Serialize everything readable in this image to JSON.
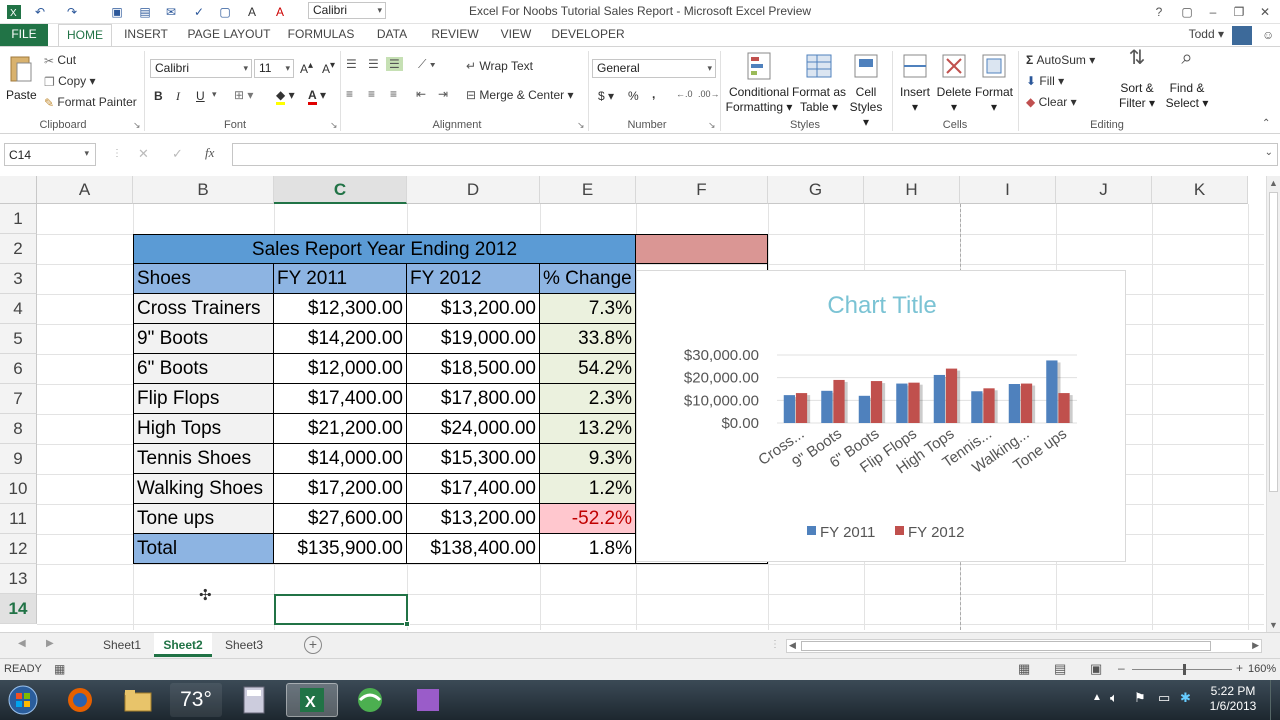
{
  "window": {
    "title": "Excel For Noobs Tutorial Sales Report - Microsoft Excel Preview",
    "user": "Todd",
    "qat_font": "Calibri"
  },
  "menu": {
    "tabs": [
      "FILE",
      "HOME",
      "INSERT",
      "PAGE LAYOUT",
      "FORMULAS",
      "DATA",
      "REVIEW",
      "VIEW",
      "DEVELOPER"
    ]
  },
  "ribbon": {
    "clipboard": {
      "paste": "Paste",
      "cut": "Cut",
      "copy": "Copy",
      "format_painter": "Format Painter",
      "label": "Clipboard"
    },
    "font": {
      "name": "Calibri",
      "size": "11",
      "bold": "B",
      "italic": "I",
      "underline": "U",
      "label": "Font"
    },
    "alignment": {
      "wrap": "Wrap Text",
      "merge": "Merge & Center",
      "label": "Alignment"
    },
    "number": {
      "format": "General",
      "currency": "$",
      "percent": "%",
      "comma": ",",
      "label": "Number"
    },
    "styles": {
      "conditional": "Conditional",
      "conditional2": "Formatting",
      "format_as": "Format as",
      "format_as2": "Table",
      "cell": "Cell",
      "cell2": "Styles",
      "label": "Styles"
    },
    "cells": {
      "insert": "Insert",
      "delete": "Delete",
      "format": "Format",
      "label": "Cells"
    },
    "editing": {
      "autosum": "AutoSum",
      "fill": "Fill",
      "clear": "Clear",
      "sort": "Sort &",
      "sort2": "Filter",
      "find": "Find &",
      "find2": "Select",
      "label": "Editing"
    }
  },
  "formula_bar": {
    "name_box": "C14",
    "fx": "fx",
    "cancel": "✕",
    "enter": "✓",
    "content": ""
  },
  "columns": [
    "A",
    "B",
    "C",
    "D",
    "E",
    "F",
    "G",
    "H",
    "I",
    "J",
    "K"
  ],
  "rows": [
    "1",
    "2",
    "3",
    "4",
    "5",
    "6",
    "7",
    "8",
    "9",
    "10",
    "11",
    "12",
    "13",
    "14"
  ],
  "table": {
    "title": "Sales Report Year Ending 2012",
    "headers": [
      "Shoes",
      "FY 2011",
      "FY 2012",
      "% Change"
    ],
    "rows": [
      [
        "Cross Trainers",
        "$12,300.00",
        "$13,200.00",
        "7.3%"
      ],
      [
        "9\" Boots",
        "$14,200.00",
        "$19,000.00",
        "33.8%"
      ],
      [
        "6\" Boots",
        "$12,000.00",
        "$18,500.00",
        "54.2%"
      ],
      [
        "Flip Flops",
        "$17,400.00",
        "$17,800.00",
        "2.3%"
      ],
      [
        "High Tops",
        "$21,200.00",
        "$24,000.00",
        "13.2%"
      ],
      [
        "Tennis Shoes",
        "$14,000.00",
        "$15,300.00",
        "9.3%"
      ],
      [
        "Walking Shoes",
        "$17,200.00",
        "$17,400.00",
        "1.2%"
      ],
      [
        "Tone ups",
        "$27,600.00",
        "$13,200.00",
        "-52.2%"
      ]
    ],
    "total": [
      "Total",
      "$135,900.00",
      "$138,400.00",
      "1.8%"
    ]
  },
  "chart_data": {
    "type": "bar",
    "title": "Chart Title",
    "categories": [
      "Cross...",
      "9\" Boots",
      "6\" Boots",
      "Flip Flops",
      "High Tops",
      "Tennis...",
      "Walking...",
      "Tone ups"
    ],
    "series": [
      {
        "name": "FY 2011",
        "values": [
          12300,
          14200,
          12000,
          17400,
          21200,
          14000,
          17200,
          27600
        ],
        "color": "#4f81bd"
      },
      {
        "name": "FY 2012",
        "values": [
          13200,
          19000,
          18500,
          17800,
          24000,
          15300,
          17400,
          13200
        ],
        "color": "#c0504d"
      }
    ],
    "ylim": [
      0,
      30000
    ],
    "yticks": [
      "$30,000.00",
      "$20,000.00",
      "$10,000.00",
      "$0.00"
    ],
    "grid": true,
    "legend": "bottom"
  },
  "sheets": [
    "Sheet1",
    "Sheet2",
    "Sheet3"
  ],
  "status": {
    "ready": "READY",
    "zoom": "160%"
  },
  "taskbar": {
    "temp": "73°",
    "time": "5:22 PM",
    "date": "1/6/2013"
  }
}
